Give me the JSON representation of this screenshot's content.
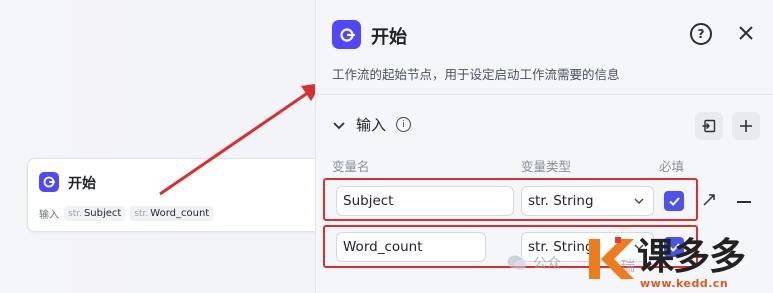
{
  "node": {
    "title": "开始",
    "io_label": "输入",
    "tags": [
      {
        "type": "str.",
        "name": "Subject"
      },
      {
        "type": "str.",
        "name": "Word_count"
      }
    ]
  },
  "panel": {
    "title": "开始",
    "help": "?",
    "description": "工作流的起始节点，用于设定启动工作流需要的信息",
    "section_title": "输入",
    "info": "i",
    "columns": {
      "name": "变量名",
      "type": "变量类型",
      "required": "必填"
    },
    "rows": [
      {
        "name": "Subject",
        "type": "str. String",
        "required": true
      },
      {
        "name": "Word_count",
        "type": "str. String",
        "required": true
      }
    ]
  },
  "watermark": {
    "left_text": "公众",
    "right_text": "瑞",
    "brand_name": "课多多",
    "url": "www.kedd.cn"
  },
  "colors": {
    "accent": "#5147ff",
    "checkbox": "#4d53e8",
    "highlight": "#d9302f",
    "brand_orange": "#f07b1c"
  }
}
